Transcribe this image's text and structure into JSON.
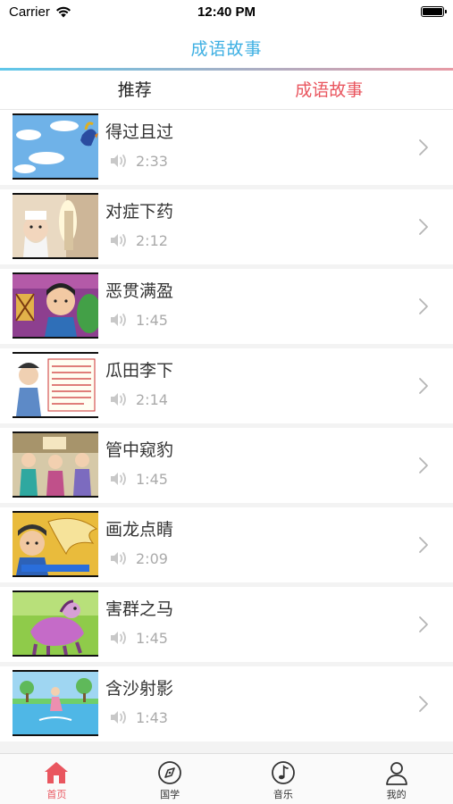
{
  "status": {
    "carrier": "Carrier",
    "time": "12:40 PM"
  },
  "nav": {
    "title": "成语故事"
  },
  "segments": [
    {
      "label": "推荐",
      "active": false
    },
    {
      "label": "成语故事",
      "active": true
    }
  ],
  "stories": [
    {
      "title": "得过且过",
      "duration": "2:33",
      "thumb": "sky-bird"
    },
    {
      "title": "对症下药",
      "duration": "2:12",
      "thumb": "doctor"
    },
    {
      "title": "恶贯满盈",
      "duration": "1:45",
      "thumb": "scholar"
    },
    {
      "title": "瓜田李下",
      "duration": "2:14",
      "thumb": "text-card"
    },
    {
      "title": "管中窥豹",
      "duration": "1:45",
      "thumb": "crowd"
    },
    {
      "title": "画龙点睛",
      "duration": "2:09",
      "thumb": "dragon"
    },
    {
      "title": "害群之马",
      "duration": "1:45",
      "thumb": "horse"
    },
    {
      "title": "含沙射影",
      "duration": "1:43",
      "thumb": "river"
    }
  ],
  "tabbar": [
    {
      "label": "首页",
      "icon": "home-icon",
      "active": true
    },
    {
      "label": "国学",
      "icon": "compass-icon",
      "active": false
    },
    {
      "label": "音乐",
      "icon": "music-note-icon",
      "active": false
    },
    {
      "label": "我的",
      "icon": "person-icon",
      "active": false
    }
  ],
  "colors": {
    "accent": "#e9565f",
    "title": "#3fb0e3",
    "meta": "#aaaaaa"
  }
}
